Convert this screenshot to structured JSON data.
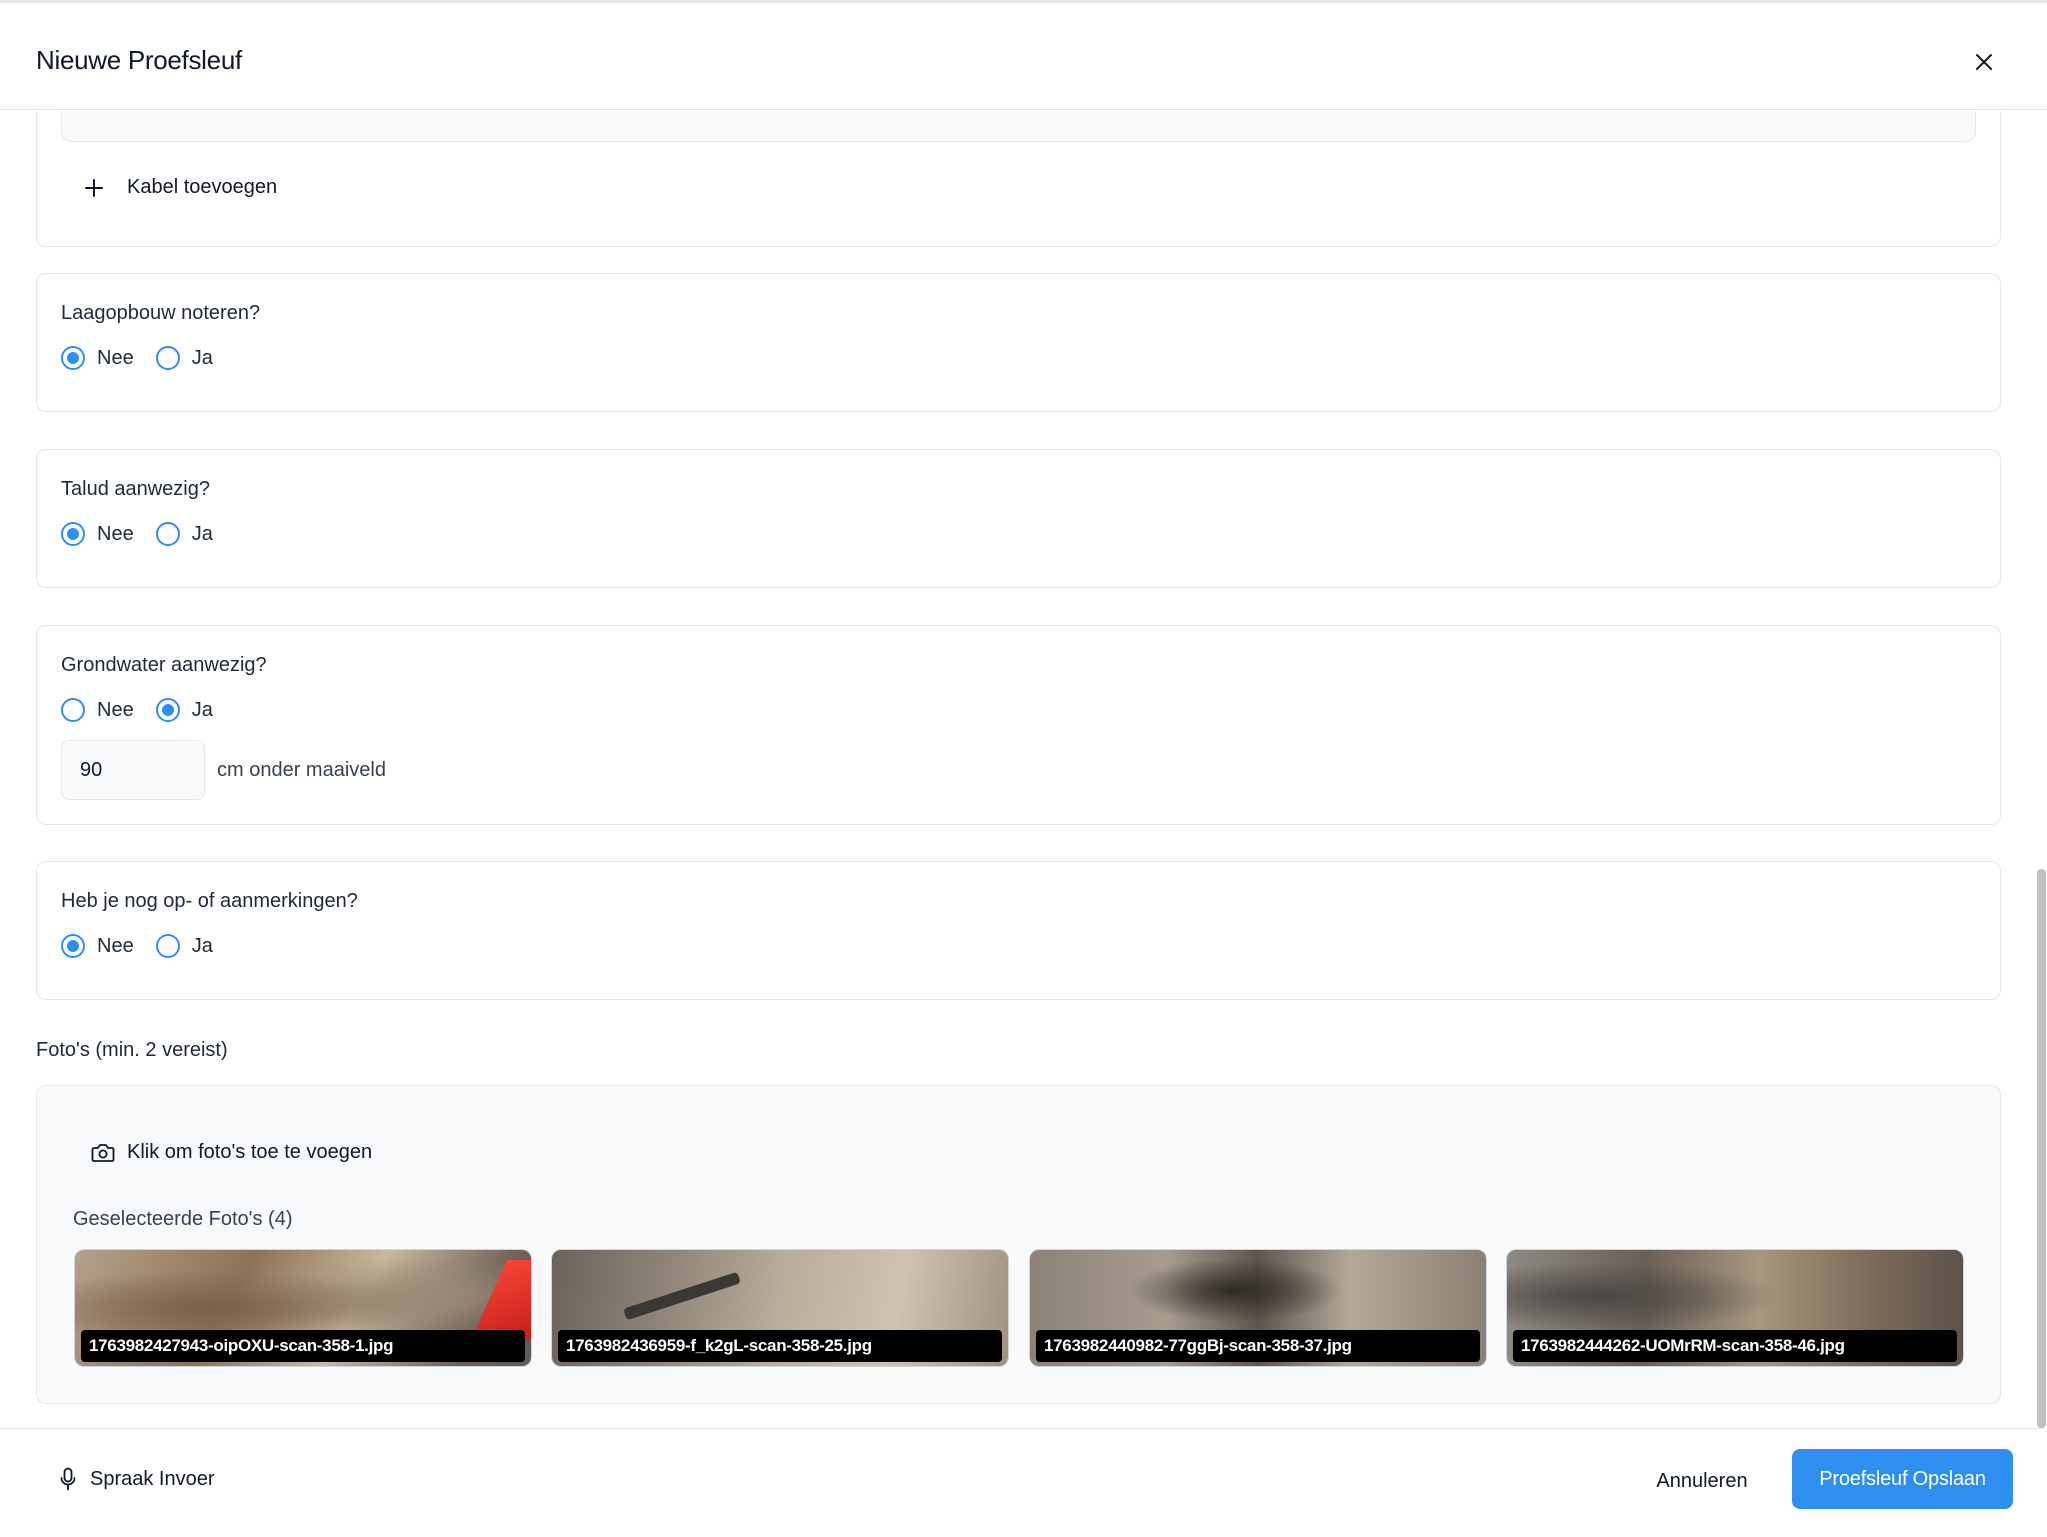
{
  "dialog": {
    "title": "Nieuwe Proefsleuf"
  },
  "cable": {
    "add_label": "Kabel toevoegen"
  },
  "questions": {
    "laagopbouw": {
      "title": "Laagopbouw noteren?",
      "options": [
        "Nee",
        "Ja"
      ],
      "selected": "Nee"
    },
    "talud": {
      "title": "Talud aanwezig?",
      "options": [
        "Nee",
        "Ja"
      ],
      "selected": "Nee"
    },
    "grondwater": {
      "title": "Grondwater aanwezig?",
      "options": [
        "Nee",
        "Ja"
      ],
      "selected": "Ja",
      "depth_value": "90",
      "depth_unit": "cm onder maaiveld"
    },
    "opmerkingen": {
      "title": "Heb je nog op- of aanmerkingen?",
      "options": [
        "Nee",
        "Ja"
      ],
      "selected": "Nee"
    }
  },
  "photos": {
    "label": "Foto's (min. 2 vereist)",
    "add_label": "Klik om foto's toe te voegen",
    "selected_label": "Geselecteerde Foto's (4)",
    "files": [
      "1763982427943-oipOXU-scan-358-1.jpg",
      "1763982436959-f_k2gL-scan-358-25.jpg",
      "1763982440982-77ggBj-scan-358-37.jpg",
      "1763982444262-UOMrRM-scan-358-46.jpg"
    ]
  },
  "footer": {
    "voice_label": "Spraak Invoer",
    "cancel_label": "Annuleren",
    "save_label": "Proefsleuf Opslaan"
  },
  "colors": {
    "accent": "#2e8ff0",
    "border": "#e5e7eb",
    "muted_bg": "#f9fafb"
  },
  "icons": {
    "close": "close-icon",
    "add": "plus-icon",
    "camera": "camera-icon",
    "microphone": "microphone-icon"
  }
}
